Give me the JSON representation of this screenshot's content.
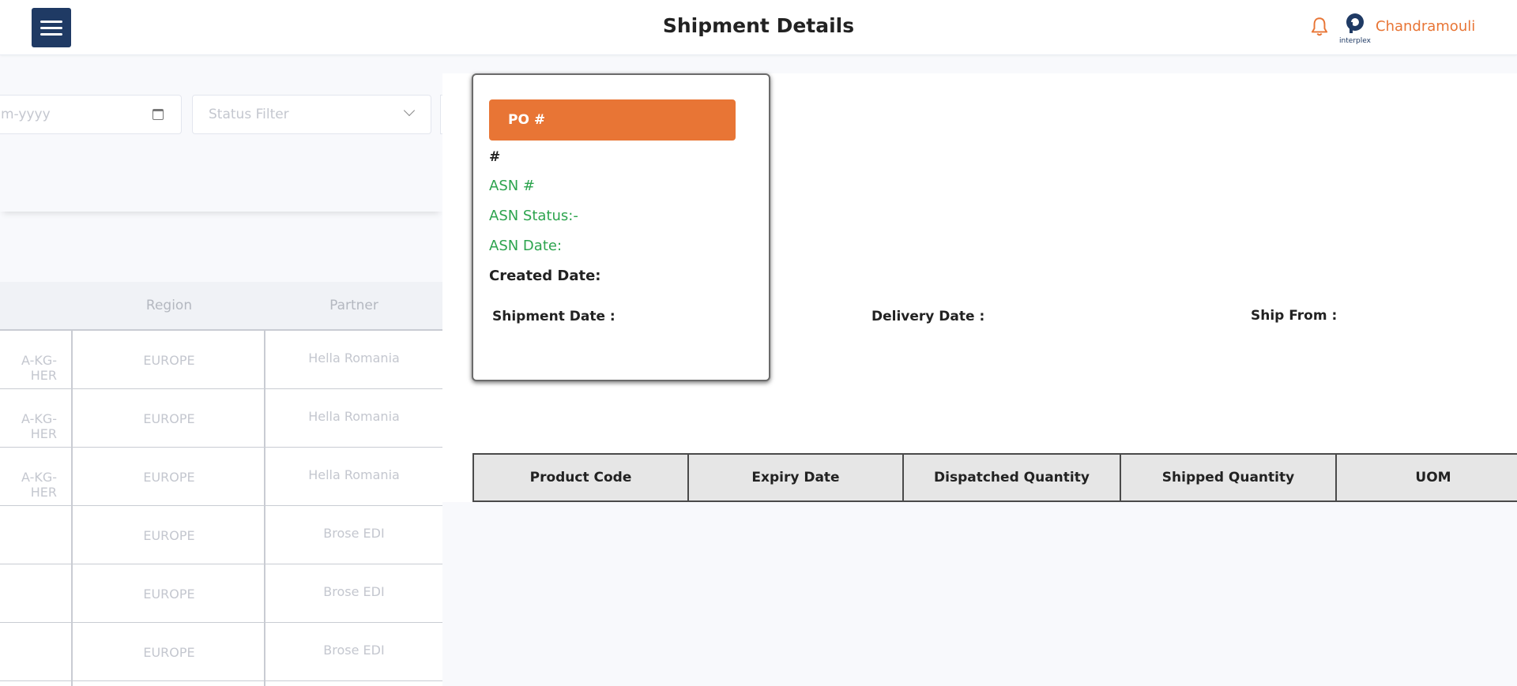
{
  "header": {
    "title": "Shipment Details",
    "user_name": "Chandramouli",
    "logo_text": "interplex"
  },
  "filters": {
    "date_placeholder": "dd-mm-yyyy",
    "date_visible": "m-yyyy",
    "status_placeholder": "Status Filter"
  },
  "bg_table": {
    "headers": [
      "Region",
      "Partner"
    ],
    "rows": [
      {
        "code": "A-KG-HER",
        "region": "EUROPE",
        "partner": "Hella Romania"
      },
      {
        "code": "A-KG-HER",
        "region": "EUROPE",
        "partner": "Hella Romania"
      },
      {
        "code": "A-KG-HER",
        "region": "EUROPE",
        "partner": "Hella Romania"
      },
      {
        "code": "",
        "region": "EUROPE",
        "partner": "Brose EDI"
      },
      {
        "code": "",
        "region": "EUROPE",
        "partner": "Brose EDI"
      },
      {
        "code": "",
        "region": "EUROPE",
        "partner": "Brose EDI"
      }
    ]
  },
  "card": {
    "po_label": "PO #",
    "hash": "#",
    "asn_number": "ASN #",
    "asn_status": "ASN Status:-",
    "asn_date": "ASN Date:",
    "created_date": "Created Date:"
  },
  "details": {
    "shipment_date": "Shipment Date :",
    "delivery_date": "Delivery Date :",
    "ship_from": "Ship From :"
  },
  "product_table": {
    "headers": [
      "Product Code",
      "Expiry Date",
      "Dispatched Quantity",
      "Shipped Quantity",
      "UOM"
    ]
  },
  "colors": {
    "accent": "#e87535",
    "nav": "#1f3a64",
    "status_green": "#2da44e"
  }
}
